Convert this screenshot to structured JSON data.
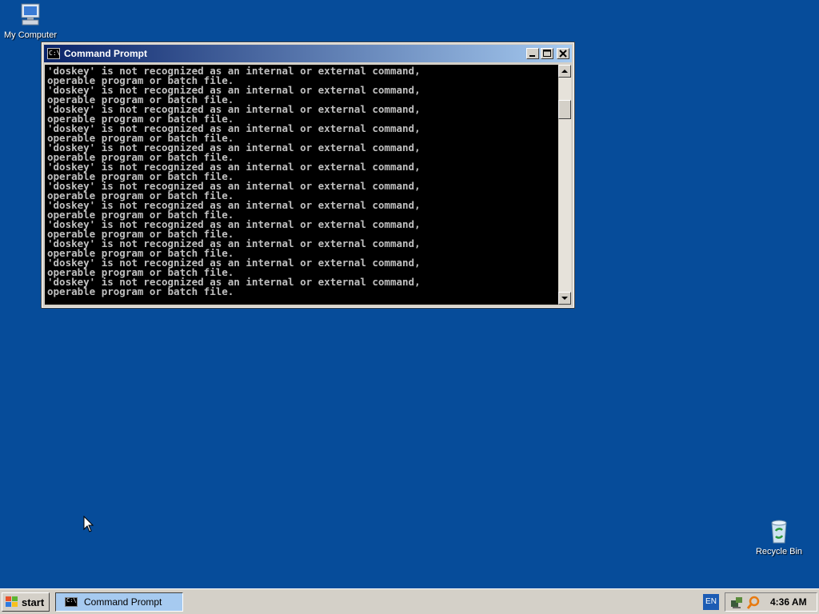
{
  "desktop": {
    "icons": [
      {
        "label": "My Computer"
      },
      {
        "label": "Recycle Bin"
      }
    ]
  },
  "window": {
    "title": "Command Prompt",
    "console_lines": [
      "'doskey' is not recognized as an internal or external command,",
      "operable program or batch file.",
      "'doskey' is not recognized as an internal or external command,",
      "operable program or batch file.",
      "'doskey' is not recognized as an internal or external command,",
      "operable program or batch file.",
      "'doskey' is not recognized as an internal or external command,",
      "operable program or batch file.",
      "'doskey' is not recognized as an internal or external command,",
      "operable program or batch file.",
      "'doskey' is not recognized as an internal or external command,",
      "operable program or batch file.",
      "'doskey' is not recognized as an internal or external command,",
      "operable program or batch file.",
      "'doskey' is not recognized as an internal or external command,",
      "operable program or batch file.",
      "'doskey' is not recognized as an internal or external command,",
      "operable program or batch file.",
      "'doskey' is not recognized as an internal or external command,",
      "operable program or batch file.",
      "'doskey' is not recognized as an internal or external command,",
      "operable program or batch file.",
      "'doskey' is not recognized as an internal or external command,",
      "operable program or batch file.",
      "_"
    ]
  },
  "taskbar": {
    "start_label": "start",
    "task_label": "Command Prompt",
    "language": "EN",
    "clock": "4:36 AM"
  },
  "colors": {
    "desktop_bg": "#064c9a",
    "titlebar_start": "#0a246a",
    "titlebar_end": "#a6caf0"
  }
}
